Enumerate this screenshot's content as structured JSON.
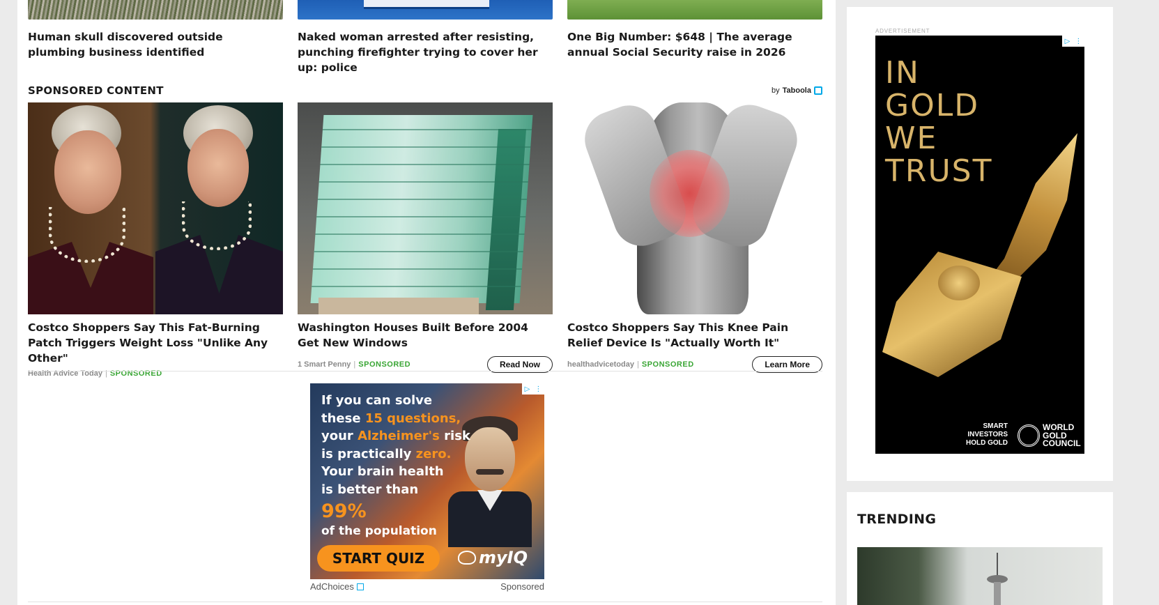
{
  "top_articles": [
    {
      "title": "Human skull discovered outside plumbing business identified"
    },
    {
      "title": "Naked woman arrested after resisting, punching firefighter trying to cover her up: police"
    },
    {
      "title": "One Big Number: $648 | The average annual Social Security raise in 2026"
    }
  ],
  "sponsored": {
    "heading": "SPONSORED CONTENT",
    "by_label": "by",
    "provider": "Taboola",
    "cards": [
      {
        "title": "Costco Shoppers Say This Fat-Burning Patch Triggers Weight Loss \"Unlike Any Other\"",
        "source": "Health Advice Today",
        "sponsored": "SPONSORED",
        "cta": ""
      },
      {
        "title": "Washington Houses Built Before 2004 Get New Windows",
        "source": "1 Smart Penny",
        "sponsored": "SPONSORED",
        "cta": "Read Now"
      },
      {
        "title": "Costco Shoppers Say This Knee Pain Relief Device Is \"Actually Worth It\"",
        "source": "healthadvicetoday",
        "sponsored": "SPONSORED",
        "cta": "Learn More"
      }
    ]
  },
  "inpage_ad": {
    "line1": "If you can solve",
    "line2a": "these ",
    "line2b": "15 questions,",
    "line3a": "your ",
    "line3b": "Alzheimer's",
    "line3c": " risk",
    "line4a": "is practically ",
    "line4b": "zero.",
    "line5": "Your brain health",
    "line6": "is better than",
    "big": "99%",
    "population": "of the population",
    "button": "START QUIZ",
    "brand": "myIQ",
    "footer_left": "AdChoices",
    "footer_right": "Sponsored"
  },
  "sidebar": {
    "ad_label": "ADVERTISEMENT",
    "gold_ad": {
      "title_lines": [
        "IN",
        "GOLD",
        "WE",
        "TRUST"
      ],
      "tagline_1": "SMART INVESTORS",
      "tagline_2": "HOLD GOLD",
      "org_1": "WORLD",
      "org_2": "GOLD",
      "org_3": "COUNCIL"
    },
    "trending_heading": "TRENDING"
  }
}
